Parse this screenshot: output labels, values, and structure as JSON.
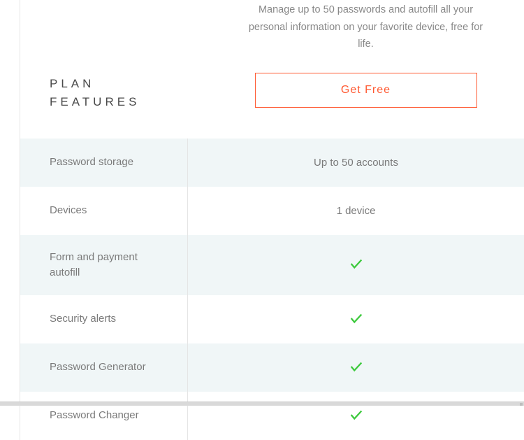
{
  "header": {
    "plan_features_title": "PLAN\nFEATURES",
    "plan_description": "Manage up to 50 passwords and autofill all your personal information on your favorite device, free for life.",
    "cta_label": "Get Free"
  },
  "features": [
    {
      "label": "Password storage",
      "value": "Up to 50 accounts",
      "has_check": false
    },
    {
      "label": "Devices",
      "value": "1 device",
      "has_check": false
    },
    {
      "label": "Form and payment autofill",
      "value": "",
      "has_check": true
    },
    {
      "label": "Security alerts",
      "value": "",
      "has_check": true
    },
    {
      "label": "Password Generator",
      "value": "",
      "has_check": true
    },
    {
      "label": "Password Changer",
      "value": "",
      "has_check": true
    }
  ],
  "colors": {
    "accent": "#ff5a33",
    "check": "#3cc93c",
    "row_alt": "#f0f6f7"
  }
}
